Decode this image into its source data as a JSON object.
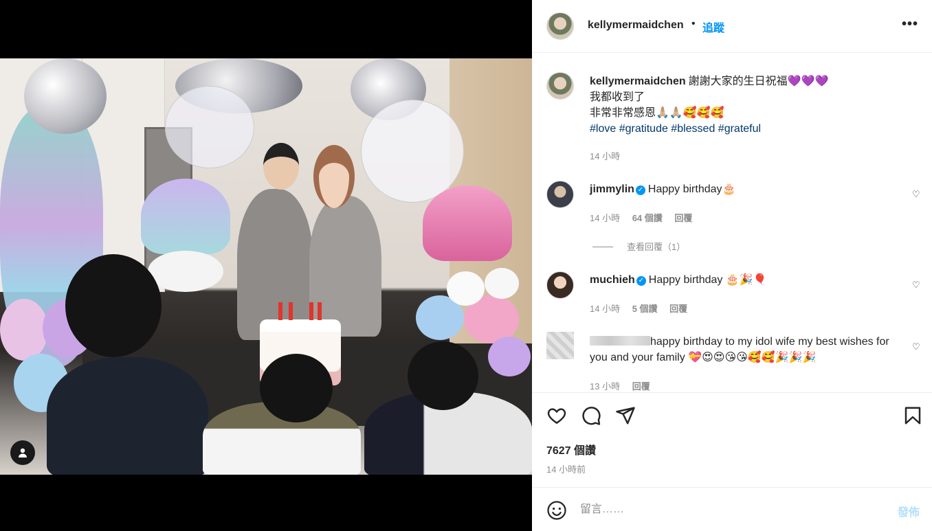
{
  "post": {
    "username": "kellymermaidchen",
    "separator": "•",
    "follow_label": "追蹤",
    "more_label": "•••"
  },
  "caption": {
    "username": "kellymermaidchen",
    "line1": "謝謝大家的生日祝福💜💜💜",
    "line2": "我都收到了",
    "line3": "非常非常感恩🙏🏼🙏🏼🥰🥰🥰",
    "hashtags": "#love #gratitude #blessed #grateful",
    "time": "14 小時"
  },
  "comments": [
    {
      "username": "jimmylin",
      "verified": true,
      "text": "Happy birthday🎂",
      "time": "14 小時",
      "likes": "64 個讚",
      "reply_label": "回覆",
      "view_replies": "查看回覆（1）"
    },
    {
      "username": "muchieh",
      "verified": true,
      "text": "Happy birthday 🎂🎉🎈",
      "time": "14 小時",
      "likes": "5 個讚",
      "reply_label": "回覆"
    },
    {
      "username": "",
      "verified": false,
      "text": "happy birthday to my idol wife my best wishes for you and your family 💝😍😍😘😘🥰🥰🎉🎉🎉",
      "time": "13 小時",
      "reply_label": "回覆"
    }
  ],
  "stats": {
    "likes": "7627 個讚",
    "posted": "14 小時前"
  },
  "compose": {
    "placeholder": "留言……",
    "post_label": "發佈"
  },
  "icons": {
    "like": "heart-icon",
    "comment": "comment-icon",
    "share": "send-icon",
    "save": "bookmark-icon",
    "emoji": "emoji-icon",
    "tag": "user-tag-icon"
  },
  "colors": {
    "accent": "#0095f6",
    "hashtag": "#00376b",
    "muted": "#8e8e8e",
    "post_disabled": "#b2dffc"
  }
}
